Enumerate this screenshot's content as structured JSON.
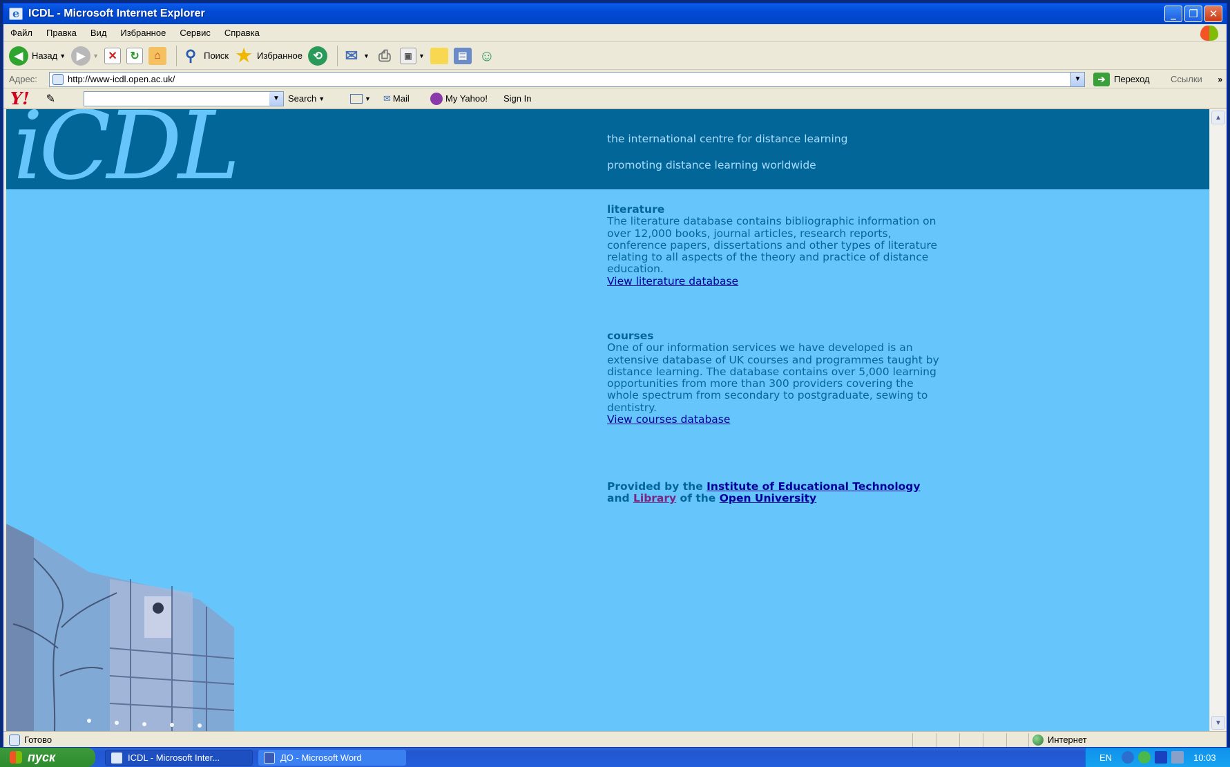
{
  "window": {
    "title": "ICDL - Microsoft Internet Explorer",
    "minimize": "_",
    "restore": "❐",
    "close": "✕"
  },
  "menu": [
    "Файл",
    "Правка",
    "Вид",
    "Избранное",
    "Сервис",
    "Справка"
  ],
  "toolbar": {
    "back": "Назад",
    "search": "Поиск",
    "favorites": "Избранное"
  },
  "address": {
    "label": "Адрес:",
    "url": "http://www-icdl.open.ac.uk/",
    "go": "Переход",
    "links": "Ссылки",
    "more": "»"
  },
  "yahoo": {
    "logo": "Y!",
    "search": "Search",
    "mail": "Mail",
    "myyahoo": "My Yahoo!",
    "signin": "Sign In"
  },
  "page": {
    "logo": "iCDL",
    "tagline1": "the international centre for distance learning",
    "tagline2": "promoting distance learning worldwide",
    "literature": {
      "heading": "literature",
      "body": "The literature database contains bibliographic information on over 12,000 books, journal articles, research reports, conference papers, dissertations and other types of literature relating to all aspects of the theory and practice of distance education.",
      "link": "View literature database"
    },
    "courses": {
      "heading": "courses",
      "body": "One of our information services we have developed is an extensive database of UK courses and programmes taught by distance learning. The database contains over 5,000 learning opportunities from more than 300 providers covering the whole spectrum from secondary to postgraduate, sewing to dentistry.",
      "link": "View courses database"
    },
    "credit": {
      "prefix": "Provided by the",
      "iet": "Institute of Educational Technology",
      "and": "and",
      "library": "Library",
      "of": "of the",
      "ou": "Open University"
    }
  },
  "status": {
    "text": "Готово",
    "zone": "Интернет"
  },
  "taskbar": {
    "start": "пуск",
    "tasks": [
      "ICDL - Microsoft Inter...",
      "ДО - Microsoft Word"
    ],
    "lang": "EN",
    "clock": "10:03"
  },
  "colors": {
    "banner": "#036699",
    "page_bg": "#66c6fc",
    "link": "#00009c",
    "visited": "#7b2680"
  }
}
